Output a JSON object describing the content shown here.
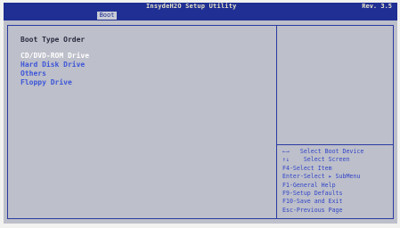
{
  "header": {
    "title": "InsydeH2O Setup Utility",
    "revision": "Rev. 3.5",
    "active_tab": "Boot"
  },
  "boot_panel": {
    "section_title": "Boot Type Order",
    "devices": [
      "CD/DVD-ROM Drive",
      "Hard Disk Drive",
      "Others",
      "Floppy Drive"
    ],
    "selected_index": 0
  },
  "help": [
    "←→   Select Boot Device",
    "↑↓    Select Screen",
    "F4-Select Item",
    "Enter-Select ▸ SubMenu",
    "F1-General Help",
    "F9-Setup Defaults",
    "F10-Save and Exit",
    "Esc-Previous Page"
  ],
  "colors": {
    "title_bar": "#1f2f93",
    "panel_bg": "#bdbfca",
    "item_text": "#3c55d8",
    "selected_text": "#ffffff"
  }
}
